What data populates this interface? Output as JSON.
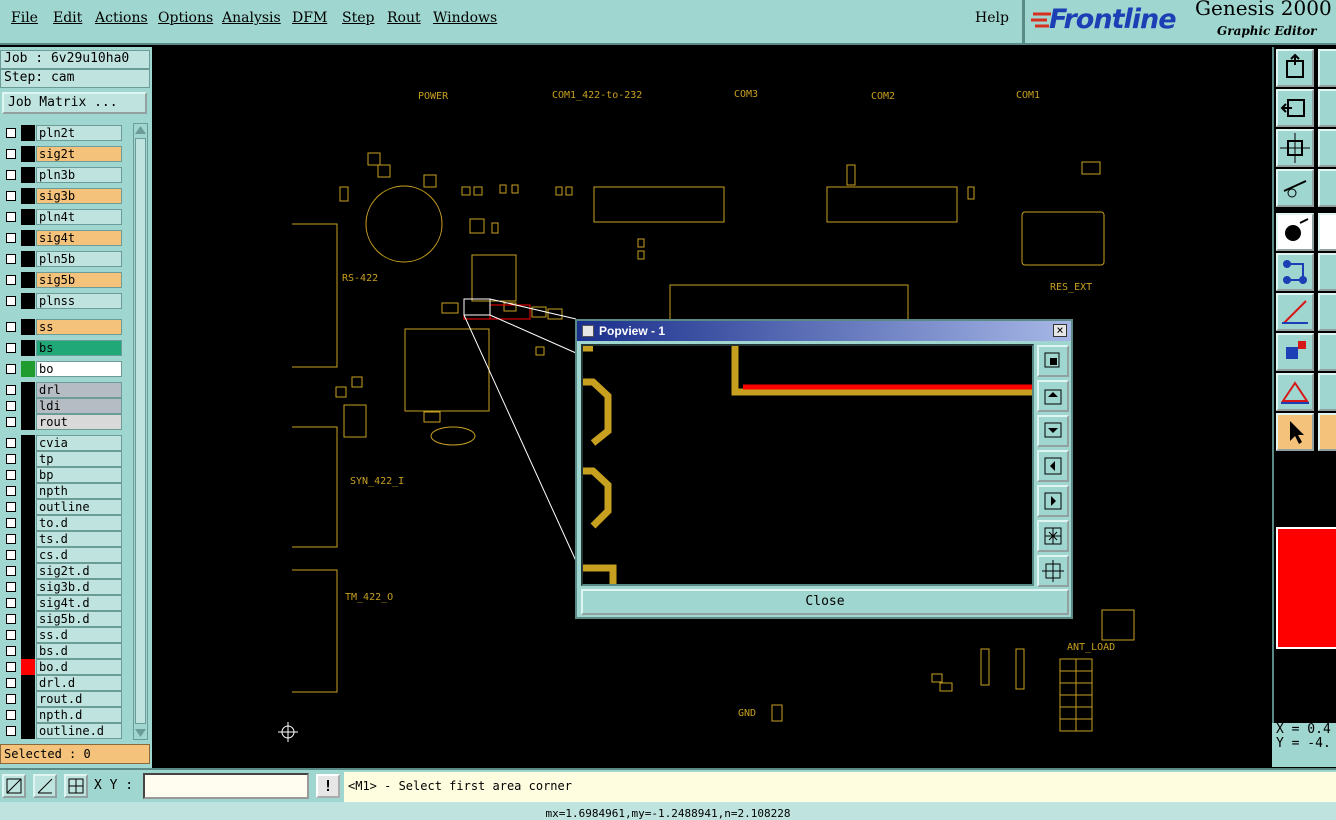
{
  "menu": [
    {
      "label": "File"
    },
    {
      "label": "Edit"
    },
    {
      "label": "Actions"
    },
    {
      "label": "Options"
    },
    {
      "label": "Analysis"
    },
    {
      "label": "DFM"
    },
    {
      "label": "Step"
    },
    {
      "label": "Rout"
    },
    {
      "label": "Windows"
    },
    {
      "label": "Help"
    }
  ],
  "brand": {
    "logo": "Frontline",
    "product": "Genesis 2000",
    "subtitle": "Graphic Editor"
  },
  "job": {
    "job_line": "Job : 6v29u10ha0",
    "step_line": "Step: cam",
    "matrix_button": "Job Matrix ..."
  },
  "layers": [
    {
      "name": "pln2t",
      "bg": "#bfe4df"
    },
    {
      "name": "sig2t",
      "bg": "#f4c27a"
    },
    {
      "name": "pln3b",
      "bg": "#bfe4df"
    },
    {
      "name": "sig3b",
      "bg": "#f4c27a"
    },
    {
      "name": "pln4t",
      "bg": "#bfe4df"
    },
    {
      "name": "sig4t",
      "bg": "#f4c27a"
    },
    {
      "name": "pln5b",
      "bg": "#bfe4df"
    },
    {
      "name": "sig5b",
      "bg": "#f4c27a"
    },
    {
      "name": "plnss",
      "bg": "#bfe4df"
    },
    {
      "name": "ss",
      "bg": "#f4c27a"
    },
    {
      "name": "bs",
      "bg": "#20a879"
    },
    {
      "name": "bo",
      "bg": "#ffffff",
      "swatch": "#1f9c2d",
      "active": true
    },
    {
      "name": "drl",
      "bg": "#b6bcc3"
    },
    {
      "name": "ldi",
      "bg": "#b6bcc3"
    },
    {
      "name": "rout",
      "bg": "#d9d9d9"
    },
    {
      "name": "cvia",
      "bg": "#bfe4df"
    },
    {
      "name": "tp",
      "bg": "#bfe4df"
    },
    {
      "name": "bp",
      "bg": "#bfe4df"
    },
    {
      "name": "npth",
      "bg": "#bfe4df"
    },
    {
      "name": "outline",
      "bg": "#bfe4df"
    },
    {
      "name": "to.d",
      "bg": "#bfe4df"
    },
    {
      "name": "ts.d",
      "bg": "#bfe4df"
    },
    {
      "name": "cs.d",
      "bg": "#bfe4df"
    },
    {
      "name": "sig2t.d",
      "bg": "#bfe4df"
    },
    {
      "name": "sig3b.d",
      "bg": "#bfe4df"
    },
    {
      "name": "sig4t.d",
      "bg": "#bfe4df"
    },
    {
      "name": "sig5b.d",
      "bg": "#bfe4df"
    },
    {
      "name": "ss.d",
      "bg": "#bfe4df"
    },
    {
      "name": "bs.d",
      "bg": "#bfe4df"
    },
    {
      "name": "bo.d",
      "bg": "#bfe4df",
      "swatch": "#ff0000"
    },
    {
      "name": "drl.d",
      "bg": "#bfe4df"
    },
    {
      "name": "rout.d",
      "bg": "#bfe4df"
    },
    {
      "name": "npth.d",
      "bg": "#bfe4df"
    },
    {
      "name": "outline.d",
      "bg": "#bfe4df"
    }
  ],
  "selected_text": "Selected : 0",
  "board_labels": {
    "power": "POWER",
    "com1_422": "COM1_422-to-232",
    "com3": "COM3",
    "com2": "COM2",
    "com1": "COM1",
    "rs422": "RS-422",
    "res_ext": "RES_EXT",
    "syn": "SYN_422_I",
    "tm": "TM_422_O",
    "ant": "ANT_LOAD",
    "gnd": "GND"
  },
  "popview": {
    "title": "Popview - 1",
    "close_label": "Close"
  },
  "bottom": {
    "xy_label": "X Y :",
    "xy_value": "",
    "message": "<M1> - Select first area corner",
    "status": "mx=1.6984961,my=-1.2488941,n=2.108228"
  },
  "coords": {
    "x_line": "X = 0.4",
    "y_line": "Y = -4."
  },
  "colors": {
    "panel": "#9fd6cf",
    "trace": "#c8a020",
    "highlight": "#ff0000",
    "selection": "#ff0000"
  }
}
